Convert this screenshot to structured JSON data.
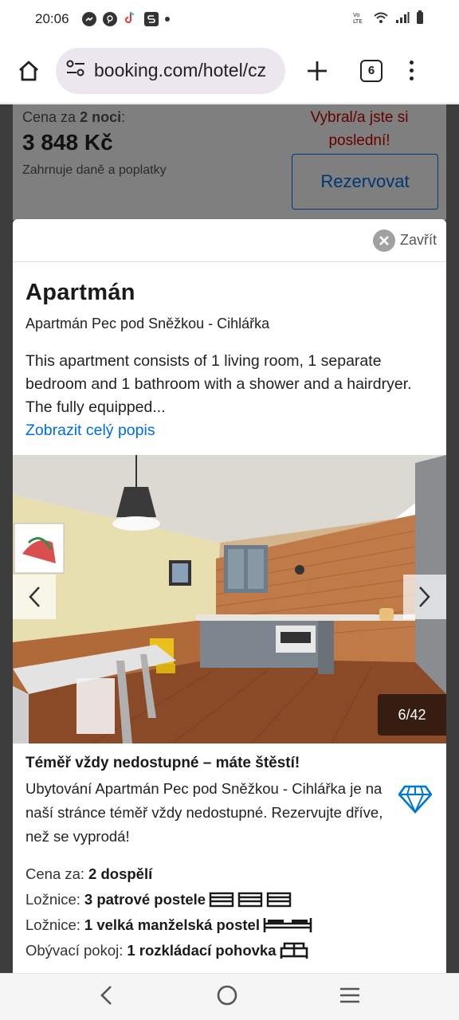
{
  "status_bar": {
    "time": "20:06",
    "left_icons": [
      "messenger-icon",
      "pinterest-icon",
      "tiktok-icon",
      "s-app-icon",
      "dot-icon"
    ],
    "right_icons": [
      "volte-icon",
      "wifi-icon",
      "signal-icon",
      "battery-icon"
    ],
    "volte_text": "VoLTE"
  },
  "browser": {
    "url": "booking.com/hotel/cz",
    "tab_count": "6"
  },
  "background_page": {
    "price_label_prefix": "Cena za",
    "price_label_nights": "2 noci",
    "price_label_suffix": ":",
    "price": "3 848 Kč",
    "tax_note": "Zahrnuje daně a poplatky",
    "urgency": "Vybral/a jste si poslední!",
    "reserve_button": "Rezervovat"
  },
  "modal": {
    "close_label": "Zavřít",
    "title": "Apartmán",
    "subtitle": "Apartmán Pec pod Sněžkou - Cihlářka",
    "description": "This apartment consists of 1 living room, 1 separate bedroom and 1 bathroom with a shower and a hairdryer. The fully equipped...",
    "show_more": "Zobrazit celý popis",
    "photo_counter": "6/42",
    "rare_title": "Téměř vždy nedostupné – máte štěstí!",
    "rare_text": "Ubytování Apartmán Pec pod Sněžkou - Cihlářka je na naší stránce téměř vždy nedostupné. Rezervujte dříve, než se vyprodá!",
    "facts": [
      {
        "label": "Cena za:",
        "value": "2 dospělí",
        "icon": "none"
      },
      {
        "label": "Ložnice:",
        "value": "3 patrové postele",
        "icon": "bunk-bed-icon"
      },
      {
        "label": "Ložnice:",
        "value": "1 velká manželská postel",
        "icon": "double-bed-icon"
      },
      {
        "label": "Obývací pokoj:",
        "value": "1 rozkládací pohovka",
        "icon": "sofa-bed-icon"
      }
    ]
  },
  "colors": {
    "link_blue": "#006ce4",
    "urgent_red": "#cc0000",
    "diamond_blue": "#0077cc"
  }
}
